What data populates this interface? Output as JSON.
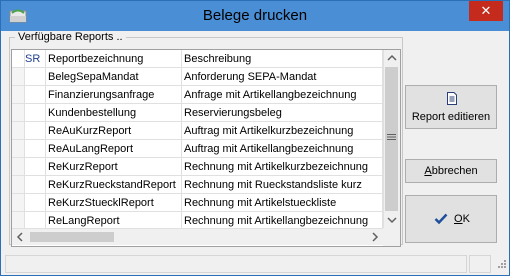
{
  "window": {
    "title": "Belege drucken",
    "close_glyph": "✕"
  },
  "group": {
    "label": "Verfügbare Reports .."
  },
  "table": {
    "columns": [
      "SR",
      "Reportbezeichnung",
      "Beschreibung"
    ],
    "rows": [
      {
        "name": "BelegSepaMandat",
        "desc": "Anforderung SEPA-Mandat"
      },
      {
        "name": "Finanzierungsanfrage",
        "desc": "Anfrage mit Artikellangbezeichnung"
      },
      {
        "name": "Kundenbestellung",
        "desc": "Reservierungsbeleg"
      },
      {
        "name": "ReAuKurzReport",
        "desc": "Auftrag mit Artikelkurzbezeichnung"
      },
      {
        "name": "ReAuLangReport",
        "desc": "Auftrag mit Artikellangbezeichnung"
      },
      {
        "name": "ReKurzReport",
        "desc": "Rechnung mit Artikelkurzbezeichnung"
      },
      {
        "name": "ReKurzRueckstandReport",
        "desc": "Rechnung mit Rueckstandsliste kurz"
      },
      {
        "name": "ReKurzStuecklReport",
        "desc": "Rechnung mit Artikelstueckliste"
      },
      {
        "name": "ReLangReport",
        "desc": "Rechnung mit Artikellangbezeichnung"
      }
    ]
  },
  "buttons": {
    "edit": "Report editieren",
    "cancel_mnemonic": "A",
    "cancel_rest": "bbrechen",
    "ok_mnemonic": "O",
    "ok_rest": "K"
  },
  "icons": {
    "app": "app-folder-icon",
    "edit": "document-icon",
    "ok": "checkmark-icon"
  }
}
